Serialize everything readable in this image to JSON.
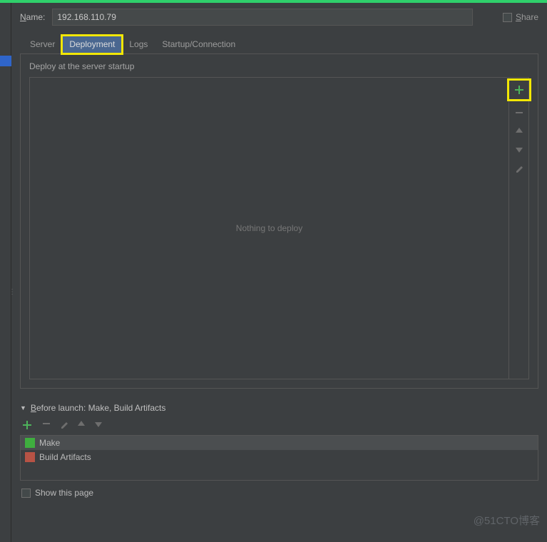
{
  "name_label_pre": "N",
  "name_label_rest": "ame:",
  "name_value": "192.168.110.79",
  "share_pre": "S",
  "share_rest": "hare",
  "tabs": {
    "server": "Server",
    "deployment": "Deployment",
    "logs": "Logs",
    "startup": "Startup/Connection"
  },
  "panel_title": "Deploy at the server startup",
  "nothing_text": "Nothing to deploy",
  "before_launch_pre": "B",
  "before_launch_rest": "efore launch: Make, Build Artifacts",
  "tasks": {
    "make": "Make",
    "build_artifacts": "Build Artifacts"
  },
  "show_page": "Show this page",
  "watermark": "@51CTO博客"
}
